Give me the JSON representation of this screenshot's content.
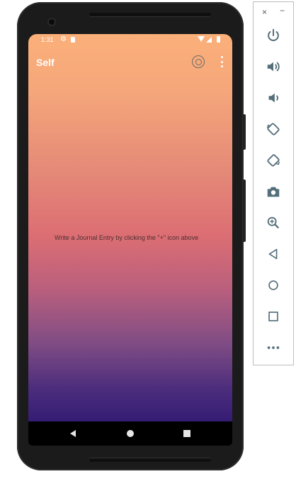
{
  "status_bar": {
    "time": "1:31"
  },
  "app_bar": {
    "title": "Self"
  },
  "main": {
    "empty_message": "Write a Journal Entry by clicking the \"+\" icon above"
  },
  "emulator_panel": {
    "close_glyph": "×",
    "minimize_glyph": "−",
    "tools": [
      "power-icon",
      "volume-up-icon",
      "volume-down-icon",
      "rotate-left-icon",
      "rotate-right-icon",
      "camera-icon",
      "zoom-icon",
      "back-icon",
      "home-icon",
      "overview-icon",
      "more-icon"
    ]
  },
  "colors": {
    "gradient_top": "#fbb07a",
    "gradient_mid": "#dc6e73",
    "gradient_bottom": "#351c73",
    "panel_icon": "#546e7a"
  }
}
